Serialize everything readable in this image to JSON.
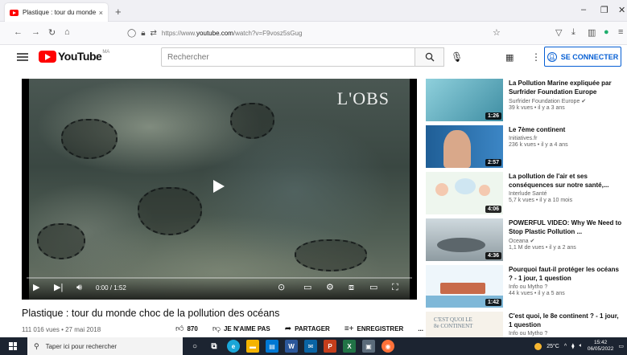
{
  "browser": {
    "tab_title": "Plastique : tour du monde choc",
    "tab_close": "×",
    "new_tab": "+",
    "url_prefix": "https://www.",
    "url_domain": "youtube.com",
    "url_path": "/watch?v=F9vosz5sGug"
  },
  "youtube": {
    "logo_text": "YouTube",
    "logo_country": "MA",
    "search_placeholder": "Rechercher",
    "signin_label": "SE CONNECTER"
  },
  "player": {
    "watermark": "L'OBS",
    "time": "0:00 / 1:52"
  },
  "video": {
    "title": "Plastique : tour du monde choc de la pollution des océans",
    "views": "111 016 vues",
    "date": "27 mai 2018",
    "likes": "870",
    "dislike_label": "JE N'AIME PAS",
    "share_label": "PARTAGER",
    "save_label": "ENREGISTRER",
    "more": "..."
  },
  "related": [
    {
      "title": "La Pollution Marine expliquée par Surfrider Foundation Europe",
      "channel": "Surfrider Foundation Europe",
      "verified": true,
      "stats": "39 k vues • il y a 3 ans",
      "duration": "1:26",
      "thumb_color": "#6fb9c9"
    },
    {
      "title": "Le 7ème continent",
      "channel": "Initiatives.fr",
      "verified": false,
      "stats": "236 k vues • il y a 4 ans",
      "duration": "2:57",
      "thumb_color": "#2d6fa8"
    },
    {
      "title": "La pollution de l'air et ses conséquences sur notre santé,...",
      "channel": "Interlude Santé",
      "verified": false,
      "stats": "5,7 k vues • il y a 10 mois",
      "duration": "4:06",
      "thumb_color": "#e6f2e6"
    },
    {
      "title": "POWERFUL VIDEO: Why We Need to Stop Plastic Pollution ...",
      "channel": "Oceana",
      "verified": true,
      "stats": "1,1 M de vues • il y a 2 ans",
      "duration": "4:36",
      "thumb_color": "#b7c7cf"
    },
    {
      "title": "Pourquoi faut-il protéger les océans ? - 1 jour, 1 question",
      "channel": "Info ou Mytho ?",
      "verified": false,
      "stats": "44 k vues • il y a 5 ans",
      "duration": "1:42",
      "thumb_color": "#eaf4fb"
    },
    {
      "title": "C'est quoi, le 8e continent ? - 1 jour, 1 question",
      "channel": "Info ou Mytho ?",
      "verified": false,
      "stats": "",
      "duration": "",
      "thumb_color": "#f4f1ea"
    }
  ],
  "taskbar": {
    "search_placeholder": "Taper ici pour rechercher",
    "weather": "25°C",
    "time": "15:42",
    "date": "06/05/2022"
  }
}
